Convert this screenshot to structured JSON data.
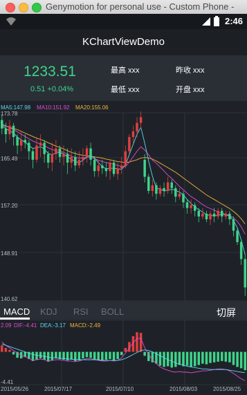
{
  "window": {
    "title": "Genymotion for personal use - Custom Phone -"
  },
  "status_bar": {
    "time": "2:46",
    "icons": [
      "wifi-icon",
      "signal-icon",
      "battery-icon"
    ]
  },
  "app_bar": {
    "title": "KChartViewDemo"
  },
  "header": {
    "price": "1233.51",
    "change": "0.51  +0.04%",
    "high_label": "最高 xxx",
    "low_label": "最低 xxx",
    "prev_close_label": "昨收 xxx",
    "open_label": "开盘 xxx"
  },
  "main_chart": {
    "ma5_label": "MA5:147.98",
    "ma10_label": "MA10:151.92",
    "ma20_label": "MA20:155.06",
    "y_labels": [
      "173.78",
      "165.49",
      "157.20",
      "148.91",
      "140.62"
    ]
  },
  "sub_chart": {
    "macd_label": "2.09",
    "dif_label": "DIF:-4.41",
    "dea_label": "DEA:-3.17",
    "macd_value_label": "MACD:-2.49",
    "bottom_label": "-4.41",
    "x_labels": [
      "2015/05/26",
      "2015/07/17",
      "2015/07/10",
      "2015/08/03",
      "2015/08/25"
    ]
  },
  "tabs": [
    {
      "label": "MACD",
      "active": true
    },
    {
      "label": "KDJ",
      "active": false
    },
    {
      "label": "RSI",
      "active": false
    },
    {
      "label": "BOLL",
      "active": false
    }
  ],
  "fullscreen_label": "切屏",
  "colors": {
    "up": "#e04040",
    "down": "#3fd48a",
    "ma5": "#5ad7f0",
    "ma10": "#e34ad8",
    "ma20": "#f1b43a"
  },
  "chart_data": {
    "type": "candlestick",
    "y_range": [
      140.62,
      173.78
    ],
    "candles": [
      {
        "o": 172.5,
        "c": 171.0,
        "h": 173.5,
        "l": 170.0
      },
      {
        "o": 171.0,
        "c": 170.0,
        "h": 172.0,
        "l": 168.5
      },
      {
        "o": 170.0,
        "c": 171.5,
        "h": 172.5,
        "l": 169.0
      },
      {
        "o": 171.5,
        "c": 169.5,
        "h": 172.0,
        "l": 168.0
      },
      {
        "o": 169.5,
        "c": 168.0,
        "h": 170.0,
        "l": 166.5
      },
      {
        "o": 168.0,
        "c": 169.0,
        "h": 170.5,
        "l": 167.0
      },
      {
        "o": 169.0,
        "c": 168.5,
        "h": 170.0,
        "l": 167.5
      },
      {
        "o": 168.5,
        "c": 167.0,
        "h": 169.0,
        "l": 165.5
      },
      {
        "o": 167.0,
        "c": 165.5,
        "h": 167.5,
        "l": 164.0
      },
      {
        "o": 165.5,
        "c": 168.0,
        "h": 169.5,
        "l": 165.0
      },
      {
        "o": 168.0,
        "c": 168.5,
        "h": 170.0,
        "l": 166.0
      },
      {
        "o": 168.5,
        "c": 166.5,
        "h": 169.0,
        "l": 165.0
      },
      {
        "o": 166.5,
        "c": 165.0,
        "h": 167.0,
        "l": 164.0
      },
      {
        "o": 165.0,
        "c": 166.5,
        "h": 168.5,
        "l": 163.5
      },
      {
        "o": 166.5,
        "c": 167.5,
        "h": 169.0,
        "l": 165.5
      },
      {
        "o": 167.5,
        "c": 166.0,
        "h": 168.0,
        "l": 165.0
      },
      {
        "o": 166.0,
        "c": 166.5,
        "h": 168.0,
        "l": 164.5
      },
      {
        "o": 166.5,
        "c": 165.0,
        "h": 167.5,
        "l": 163.0
      },
      {
        "o": 165.0,
        "c": 166.0,
        "h": 167.5,
        "l": 164.0
      },
      {
        "o": 166.0,
        "c": 164.5,
        "h": 167.0,
        "l": 163.5
      },
      {
        "o": 164.5,
        "c": 165.5,
        "h": 167.0,
        "l": 164.0
      },
      {
        "o": 165.5,
        "c": 166.0,
        "h": 167.5,
        "l": 164.5
      },
      {
        "o": 166.0,
        "c": 167.5,
        "h": 168.0,
        "l": 165.0
      },
      {
        "o": 167.5,
        "c": 165.5,
        "h": 168.5,
        "l": 164.5
      },
      {
        "o": 165.5,
        "c": 163.5,
        "h": 166.0,
        "l": 162.5
      },
      {
        "o": 163.5,
        "c": 164.5,
        "h": 165.5,
        "l": 162.5
      },
      {
        "o": 164.5,
        "c": 164.0,
        "h": 165.5,
        "l": 163.0
      },
      {
        "o": 164.0,
        "c": 163.5,
        "h": 165.0,
        "l": 162.5
      },
      {
        "o": 163.5,
        "c": 165.0,
        "h": 165.5,
        "l": 162.0
      },
      {
        "o": 165.0,
        "c": 163.0,
        "h": 165.5,
        "l": 162.5
      },
      {
        "o": 163.0,
        "c": 164.0,
        "h": 165.0,
        "l": 162.0
      },
      {
        "o": 164.0,
        "c": 164.5,
        "h": 166.0,
        "l": 163.0
      },
      {
        "o": 164.5,
        "c": 167.0,
        "h": 168.0,
        "l": 164.0
      },
      {
        "o": 167.0,
        "c": 169.5,
        "h": 170.0,
        "l": 166.5
      },
      {
        "o": 169.5,
        "c": 170.5,
        "h": 171.5,
        "l": 168.5
      },
      {
        "o": 170.5,
        "c": 172.0,
        "h": 173.0,
        "l": 169.5
      },
      {
        "o": 172.0,
        "c": 173.0,
        "h": 174.0,
        "l": 171.0
      },
      {
        "o": 165.5,
        "c": 162.5,
        "h": 166.5,
        "l": 161.5
      },
      {
        "o": 162.5,
        "c": 160.0,
        "h": 163.0,
        "l": 159.5
      },
      {
        "o": 160.0,
        "c": 161.0,
        "h": 162.0,
        "l": 159.0
      },
      {
        "o": 161.0,
        "c": 159.5,
        "h": 161.5,
        "l": 158.5
      },
      {
        "o": 159.5,
        "c": 160.5,
        "h": 161.0,
        "l": 159.0
      },
      {
        "o": 160.5,
        "c": 160.0,
        "h": 161.5,
        "l": 159.0
      },
      {
        "o": 160.0,
        "c": 161.5,
        "h": 162.5,
        "l": 159.5
      },
      {
        "o": 161.5,
        "c": 160.5,
        "h": 162.0,
        "l": 159.5
      },
      {
        "o": 160.5,
        "c": 159.0,
        "h": 161.0,
        "l": 158.0
      },
      {
        "o": 159.0,
        "c": 159.5,
        "h": 160.5,
        "l": 158.5
      },
      {
        "o": 159.5,
        "c": 158.0,
        "h": 160.0,
        "l": 157.0
      },
      {
        "o": 158.0,
        "c": 157.0,
        "h": 158.5,
        "l": 156.0
      },
      {
        "o": 157.0,
        "c": 157.5,
        "h": 158.5,
        "l": 156.0
      },
      {
        "o": 157.5,
        "c": 156.5,
        "h": 158.0,
        "l": 155.5
      },
      {
        "o": 156.5,
        "c": 155.5,
        "h": 157.0,
        "l": 154.5
      },
      {
        "o": 155.5,
        "c": 156.0,
        "h": 157.0,
        "l": 155.0
      },
      {
        "o": 156.0,
        "c": 155.0,
        "h": 156.5,
        "l": 154.5
      },
      {
        "o": 155.0,
        "c": 156.0,
        "h": 156.5,
        "l": 154.0
      },
      {
        "o": 156.0,
        "c": 155.5,
        "h": 157.0,
        "l": 154.5
      },
      {
        "o": 155.5,
        "c": 156.5,
        "h": 157.0,
        "l": 155.0
      },
      {
        "o": 156.5,
        "c": 155.5,
        "h": 157.0,
        "l": 154.5
      },
      {
        "o": 155.5,
        "c": 156.0,
        "h": 156.5,
        "l": 155.0
      },
      {
        "o": 156.0,
        "c": 155.0,
        "h": 156.5,
        "l": 154.0
      },
      {
        "o": 155.0,
        "c": 153.0,
        "h": 155.5,
        "l": 152.0
      },
      {
        "o": 153.0,
        "c": 151.0,
        "h": 153.5,
        "l": 150.5
      },
      {
        "o": 151.0,
        "c": 148.0,
        "h": 151.5,
        "l": 147.0
      },
      {
        "o": 148.0,
        "c": 143.0,
        "h": 149.0,
        "l": 141.5
      }
    ],
    "ma5": [
      171.5,
      171.0,
      170.6,
      170.2,
      169.5,
      169.0,
      168.6,
      168.0,
      167.5,
      167.6,
      167.8,
      167.4,
      166.6,
      166.4,
      166.7,
      166.8,
      166.5,
      166.0,
      165.6,
      165.2,
      165.0,
      165.4,
      166.0,
      166.3,
      165.8,
      165.0,
      164.3,
      163.9,
      164.0,
      164.0,
      163.9,
      163.8,
      164.6,
      166.4,
      168.2,
      170.0,
      171.2,
      168.4,
      165.3,
      162.6,
      160.5,
      160.3,
      160.0,
      160.1,
      160.3,
      160.1,
      159.8,
      159.3,
      158.5,
      157.8,
      157.2,
      156.7,
      156.3,
      155.8,
      155.7,
      155.6,
      155.7,
      155.9,
      155.8,
      155.6,
      154.8,
      153.5,
      151.4,
      148.8
    ],
    "ma10": [
      171.8,
      171.5,
      171.2,
      170.8,
      170.4,
      170.0,
      169.6,
      169.2,
      168.8,
      168.5,
      168.3,
      168.0,
      167.6,
      167.3,
      167.1,
      167.0,
      166.8,
      166.5,
      166.1,
      165.9,
      165.8,
      165.8,
      165.9,
      165.9,
      165.7,
      165.4,
      165.2,
      165.0,
      164.9,
      164.7,
      164.5,
      164.3,
      164.3,
      165.1,
      166.0,
      167.0,
      167.8,
      167.2,
      166.4,
      165.4,
      164.9,
      164.2,
      163.5,
      162.8,
      162.2,
      161.5,
      160.8,
      160.2,
      159.6,
      159.0,
      158.6,
      158.1,
      157.6,
      157.2,
      156.9,
      156.6,
      156.3,
      156.1,
      155.9,
      155.7,
      155.3,
      154.6,
      153.7,
      152.4
    ],
    "ma20": [
      171.6,
      171.4,
      171.2,
      171.0,
      170.8,
      170.5,
      170.2,
      169.9,
      169.6,
      169.3,
      169.1,
      168.8,
      168.5,
      168.2,
      167.9,
      167.7,
      167.4,
      167.1,
      166.8,
      166.6,
      166.4,
      166.3,
      166.2,
      166.1,
      166.0,
      165.9,
      165.8,
      165.6,
      165.5,
      165.3,
      165.2,
      165.1,
      165.0,
      165.1,
      165.3,
      165.5,
      165.8,
      165.9,
      165.8,
      165.6,
      165.3,
      164.9,
      164.5,
      164.1,
      163.7,
      163.3,
      162.8,
      162.3,
      161.8,
      161.3,
      160.8,
      160.3,
      159.8,
      159.3,
      158.9,
      158.5,
      158.1,
      157.7,
      157.3,
      156.9,
      156.4,
      155.8,
      155.1,
      154.2
    ],
    "macd_hist": [
      1.0,
      0.6,
      0.3,
      -0.4,
      -0.9,
      -1.0,
      -0.8,
      -1.1,
      -1.4,
      -1.2,
      -1.0,
      -1.2,
      -1.5,
      -1.3,
      -1.0,
      -1.1,
      -1.2,
      -1.3,
      -1.2,
      -1.4,
      -1.3,
      -1.0,
      -0.8,
      -0.9,
      -1.2,
      -1.3,
      -1.3,
      -1.2,
      -1.1,
      -1.3,
      -1.1,
      -0.5,
      0.6,
      1.5,
      2.4,
      3.0,
      2.9,
      -0.6,
      -1.4,
      -1.6,
      -1.8,
      -2.1,
      -2.3,
      -2.2,
      -2.4,
      -2.3,
      -2.0,
      -2.2,
      -2.1,
      -2.3,
      -2.2,
      -2.0,
      -1.8,
      -1.9,
      -1.7,
      -1.6,
      -1.5,
      -1.4,
      -1.5,
      -1.6,
      -2.0,
      -2.3,
      -2.5,
      -2.8
    ],
    "dif": [
      1.5,
      1.0,
      0.6,
      0.2,
      -0.2,
      -0.5,
      -0.7,
      -1.0,
      -1.3,
      -1.2,
      -1.1,
      -1.2,
      -1.4,
      -1.3,
      -1.2,
      -1.2,
      -1.3,
      -1.4,
      -1.4,
      -1.5,
      -1.4,
      -1.2,
      -1.0,
      -1.0,
      -1.2,
      -1.3,
      -1.4,
      -1.4,
      -1.3,
      -1.4,
      -1.3,
      -0.9,
      -0.2,
      0.6,
      1.4,
      2.0,
      2.1,
      0.6,
      -0.4,
      -1.2,
      -1.8,
      -2.3,
      -2.6,
      -2.8,
      -3.0,
      -3.1,
      -3.0,
      -3.1,
      -3.1,
      -3.2,
      -3.1,
      -3.0,
      -2.9,
      -2.9,
      -2.8,
      -2.7,
      -2.6,
      -2.6,
      -2.7,
      -2.9,
      -3.3,
      -3.7,
      -4.1,
      -4.41
    ],
    "dea": [
      1.2,
      1.0,
      0.8,
      0.6,
      0.4,
      0.2,
      0.0,
      -0.2,
      -0.4,
      -0.5,
      -0.6,
      -0.7,
      -0.8,
      -0.9,
      -0.9,
      -1.0,
      -1.0,
      -1.1,
      -1.1,
      -1.2,
      -1.2,
      -1.2,
      -1.2,
      -1.2,
      -1.2,
      -1.2,
      -1.3,
      -1.3,
      -1.3,
      -1.3,
      -1.3,
      -1.2,
      -1.0,
      -0.7,
      -0.4,
      -0.1,
      0.2,
      0.3,
      0.2,
      0.0,
      -0.3,
      -0.6,
      -0.9,
      -1.2,
      -1.4,
      -1.7,
      -1.9,
      -2.0,
      -2.2,
      -2.3,
      -2.4,
      -2.5,
      -2.6,
      -2.6,
      -2.7,
      -2.7,
      -2.7,
      -2.7,
      -2.7,
      -2.8,
      -2.9,
      -3.0,
      -3.1,
      -3.17
    ]
  }
}
